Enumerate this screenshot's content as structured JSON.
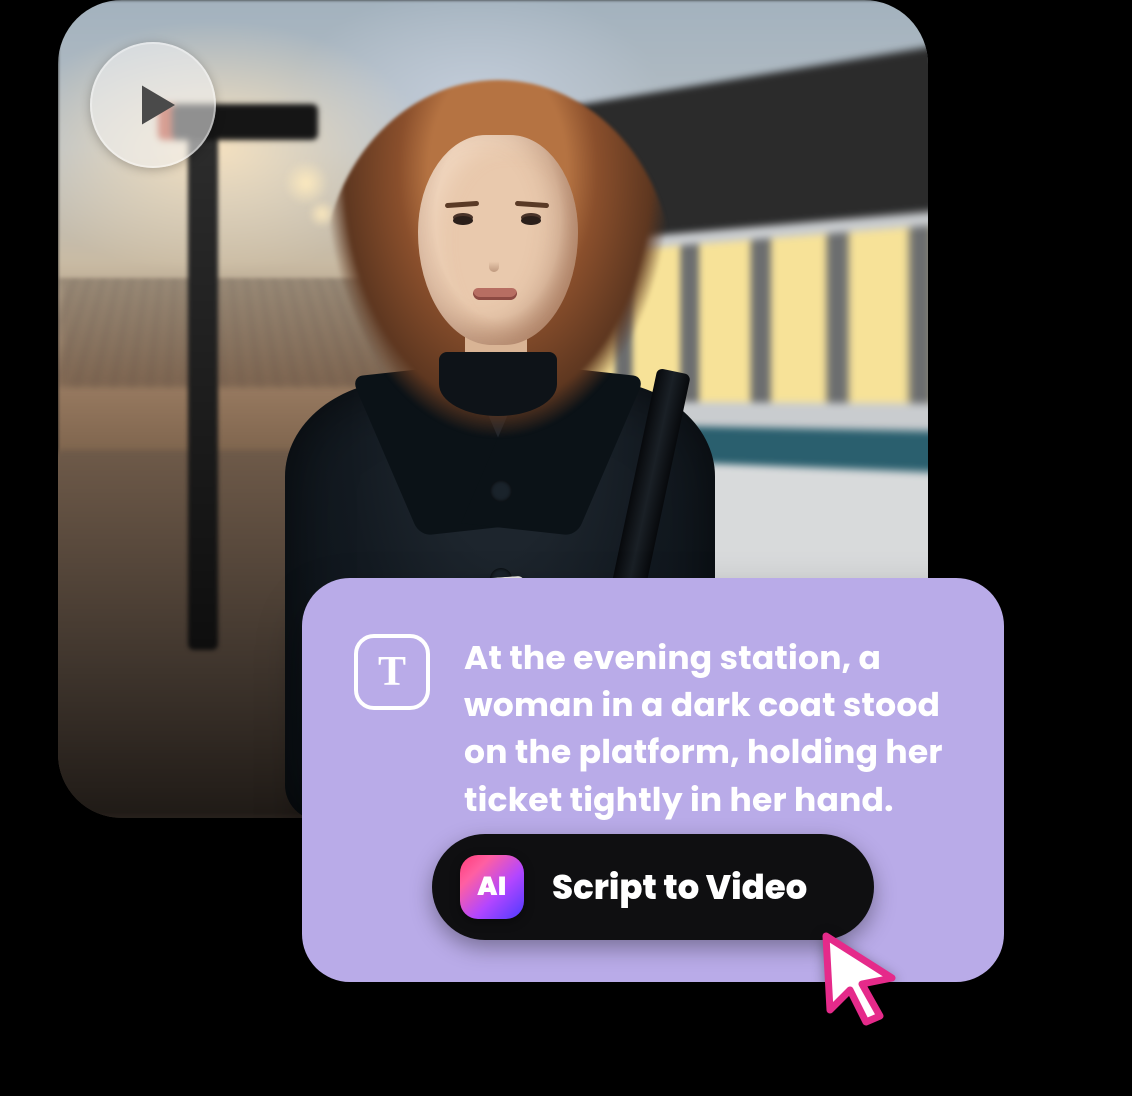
{
  "thumbnail": {
    "alt": "Woman in dark coat holding a ticket on a train platform at evening",
    "play_icon": "play-icon"
  },
  "script": {
    "icon": "text-icon",
    "text": "At the evening station, a woman in a dark coat stood on the platform, holding her ticket tightly in her hand."
  },
  "cta": {
    "ai_badge": "AI",
    "label": "Script to Video"
  },
  "cursor_icon": "cursor-arrow-icon",
  "colors": {
    "card_bg": "#b9abe8",
    "cta_bg": "#0f0f11",
    "ai_gradient_from": "#ff3d77",
    "ai_gradient_to": "#4b3bff",
    "cursor_stroke": "#e52a8a"
  }
}
